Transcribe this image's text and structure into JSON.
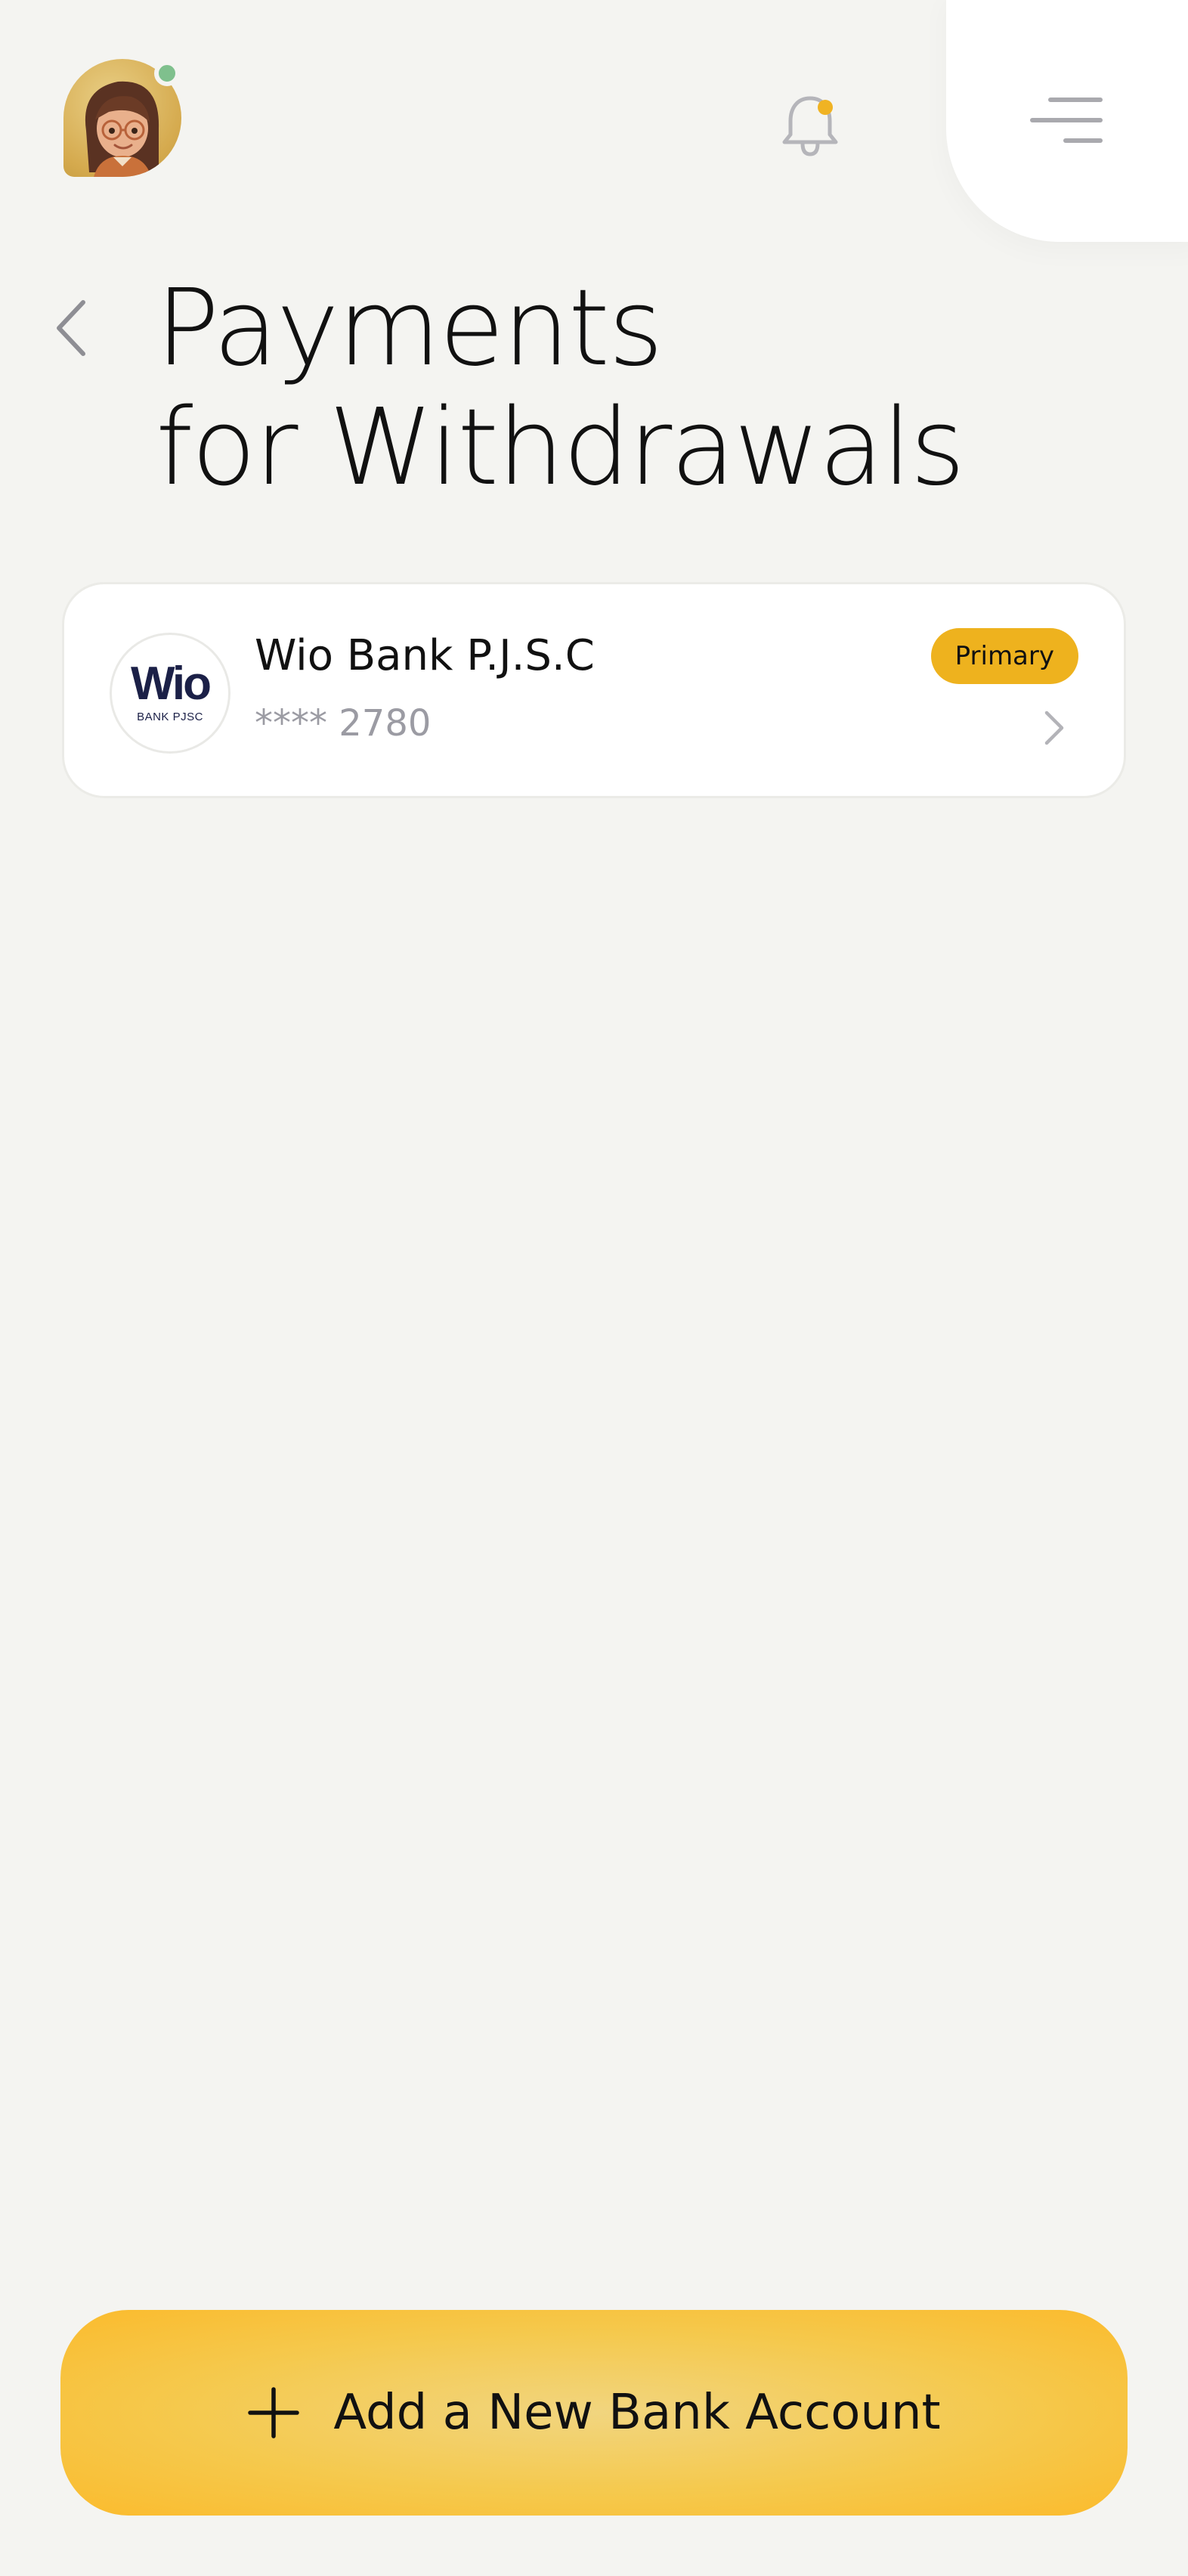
{
  "header": {
    "avatar_icon": "user-avatar",
    "online_status_color": "#7fc08d",
    "notification_icon": "bell-icon",
    "notification_dot_color": "#f0b323",
    "menu_icon": "menu-icon"
  },
  "page": {
    "title_line1": "Payments",
    "title_line2": "for Withdrawals",
    "back_icon": "chevron-left-icon"
  },
  "accounts": [
    {
      "logo_text": "Wio",
      "logo_subtext": "BANK PJSC",
      "bank_name": "Wio Bank P.J.S.C",
      "masked_number": "**** 2780",
      "badge": "Primary",
      "badge_color": "#eeb21e"
    }
  ],
  "footer": {
    "add_button_label": "Add a New Bank Account",
    "add_icon": "plus-icon",
    "accent_color": "#fbbb2d"
  }
}
